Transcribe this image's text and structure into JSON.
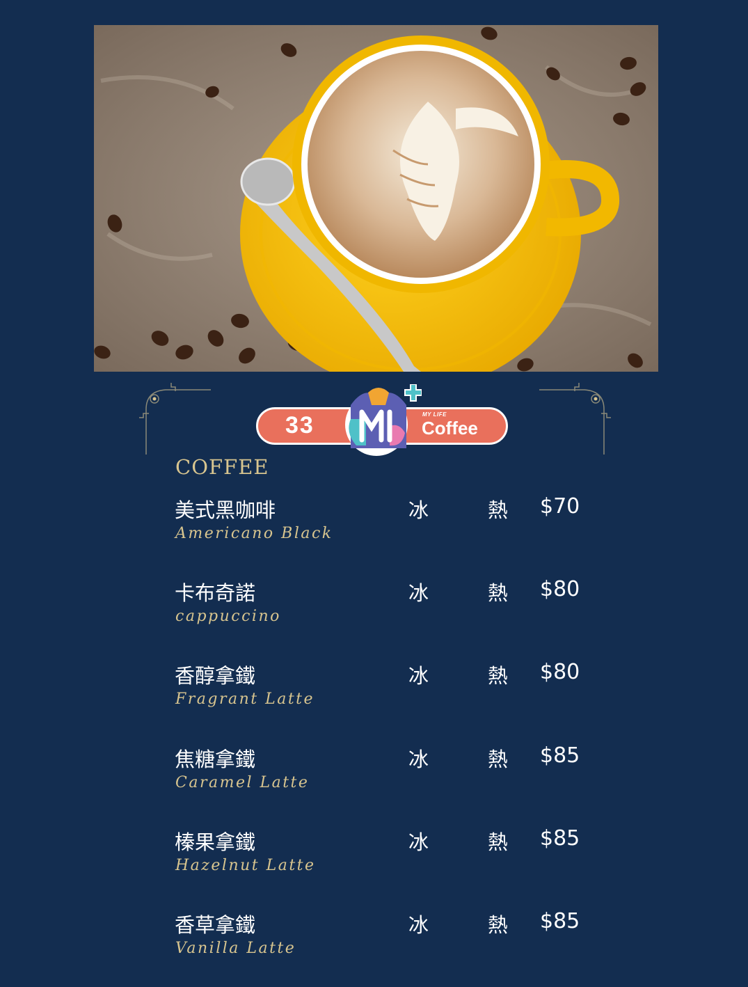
{
  "logo": {
    "number": "33",
    "small_text": "MY LIFE",
    "word": "Coffee"
  },
  "section_title": "COFFEE",
  "items": [
    {
      "zh": "美式黑咖啡",
      "en": "Americano Black",
      "ice": "冰",
      "hot": "熱",
      "price": "$70"
    },
    {
      "zh": "卡布奇諾",
      "en": "cappuccino",
      "ice": "冰",
      "hot": "熱",
      "price": "$80"
    },
    {
      "zh": "香醇拿鐵",
      "en": "Fragrant Latte",
      "ice": "冰",
      "hot": "熱",
      "price": "$80"
    },
    {
      "zh": "焦糖拿鐵",
      "en": "Caramel Latte",
      "ice": "冰",
      "hot": "熱",
      "price": "$85"
    },
    {
      "zh": "榛果拿鐵",
      "en": "Hazelnut Latte",
      "ice": "冰",
      "hot": "熱",
      "price": "$85"
    },
    {
      "zh": "香草拿鐵",
      "en": "Vanilla Latte",
      "ice": "冰",
      "hot": "熱",
      "price": "$85"
    }
  ],
  "colors": {
    "background": "#132d50",
    "accent_gold": "#d8c58f",
    "logo_coral": "#e9705c"
  }
}
